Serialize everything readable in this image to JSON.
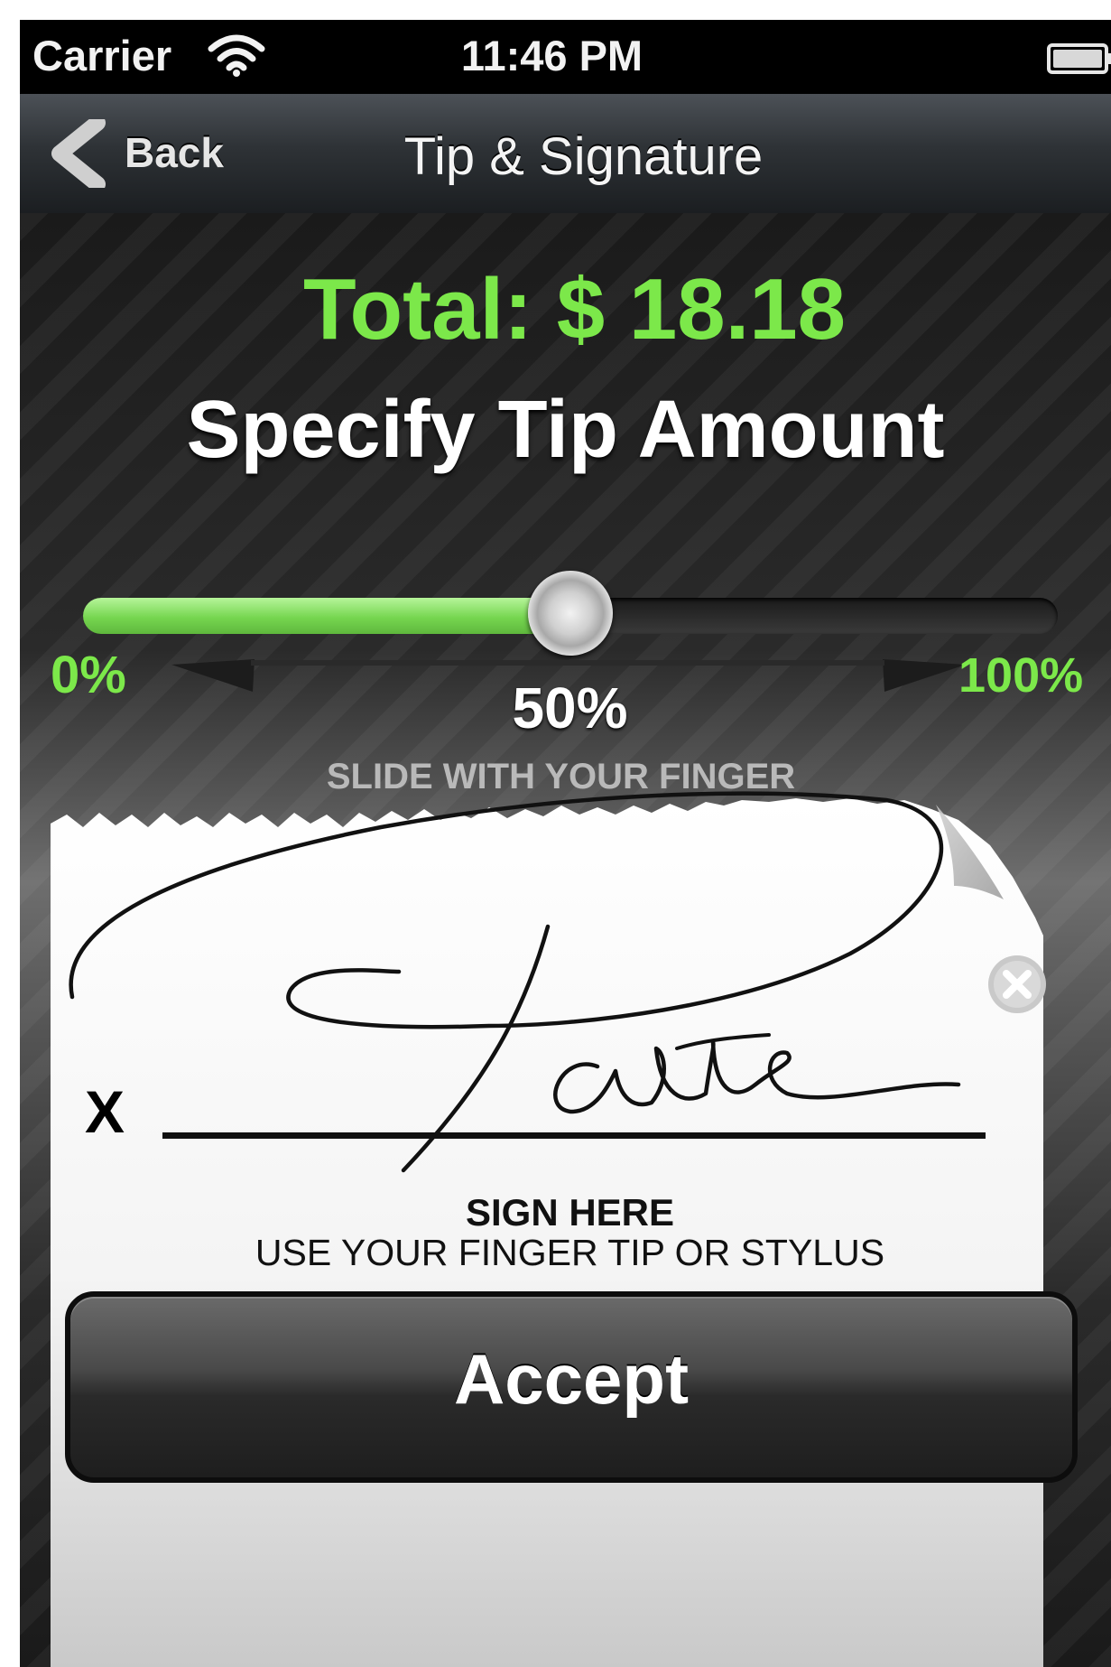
{
  "status_bar": {
    "carrier": "Carrier",
    "time": "11:46 PM",
    "icons": [
      "wifi-icon",
      "battery-icon"
    ]
  },
  "nav_bar": {
    "back_label": "Back",
    "title": "Tip & Signature",
    "icons": [
      "back-chevron-icon"
    ]
  },
  "payment": {
    "total": "Total: $ 18.18",
    "heading": "Specify Tip Amount"
  },
  "tip_slider": {
    "value_percent": 50,
    "min_label": "0%",
    "max_label": "100%",
    "value_label": "50%",
    "hint": "SLIDE WITH YOUR FINGER",
    "icons": [
      "slider-arrows-icon"
    ]
  },
  "signature": {
    "x_mark": "X",
    "sign_here": "SIGN HERE",
    "instruction": "USE YOUR FINGER TIP OR STYLUS",
    "icons": [
      "clear-circle-x-icon"
    ]
  },
  "actions": {
    "accept_label": "Accept"
  },
  "colors": {
    "accent_green": "#7ce84a",
    "slider_fill": "#76d650",
    "nav_bar": "#2e3236",
    "background": "#1a1a1a"
  }
}
